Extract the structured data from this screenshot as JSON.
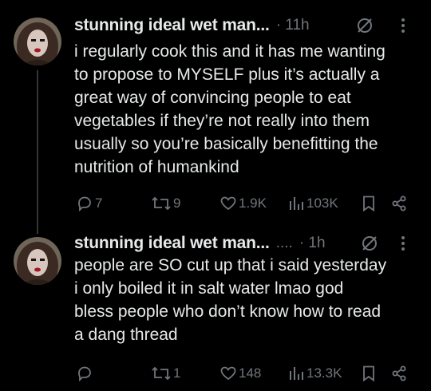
{
  "posts": [
    {
      "author": "stunning ideal wet man...",
      "time_sep": "· 11h",
      "text": "i regularly cook this and it has me wanting\nto propose to MYSELF plus it’s actually a\ngreat way of convincing people to eat\nvegetables if they’re not really into them\nusually so you’re basically benefitting the\nnutrition of humankind",
      "replies": "7",
      "reposts": "9",
      "likes": "1.9K",
      "views": "103K"
    },
    {
      "author": "stunning ideal wet man...",
      "handle_trunc": "....",
      "time_sep": "· 1h",
      "text": "people are SO cut up that i said yesterday\ni only boiled it in salt water lmao god\nbless people who don’t know how to read\na dang thread",
      "replies": "",
      "reposts": "1",
      "likes": "148",
      "views": "13.3K"
    }
  ],
  "colors": {
    "background": "#000000",
    "text": "#e7e9ea",
    "muted": "#71767b",
    "thread_line": "#333639"
  },
  "icons": [
    "reply-icon",
    "repost-icon",
    "like-icon",
    "views-icon",
    "bookmark-icon",
    "share-icon",
    "hide-icon",
    "more-icon"
  ]
}
